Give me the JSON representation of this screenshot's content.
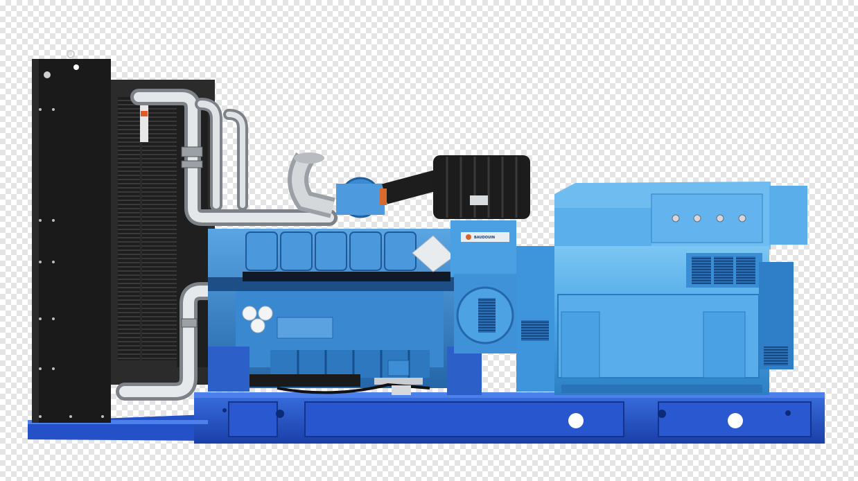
{
  "image": {
    "subject": "diesel-generator-set",
    "background": "transparency-checkerboard",
    "colors": {
      "engine_blue": "#3d8fd8",
      "alternator_blue": "#4aa6e6",
      "base_frame_blue": "#1f50c8",
      "radiator_black": "#1a1a1a",
      "pipe_silver": "#c8ccd0",
      "air_filter_black": "#1c1c1c"
    },
    "logo_text": "BAUDOUIN"
  }
}
